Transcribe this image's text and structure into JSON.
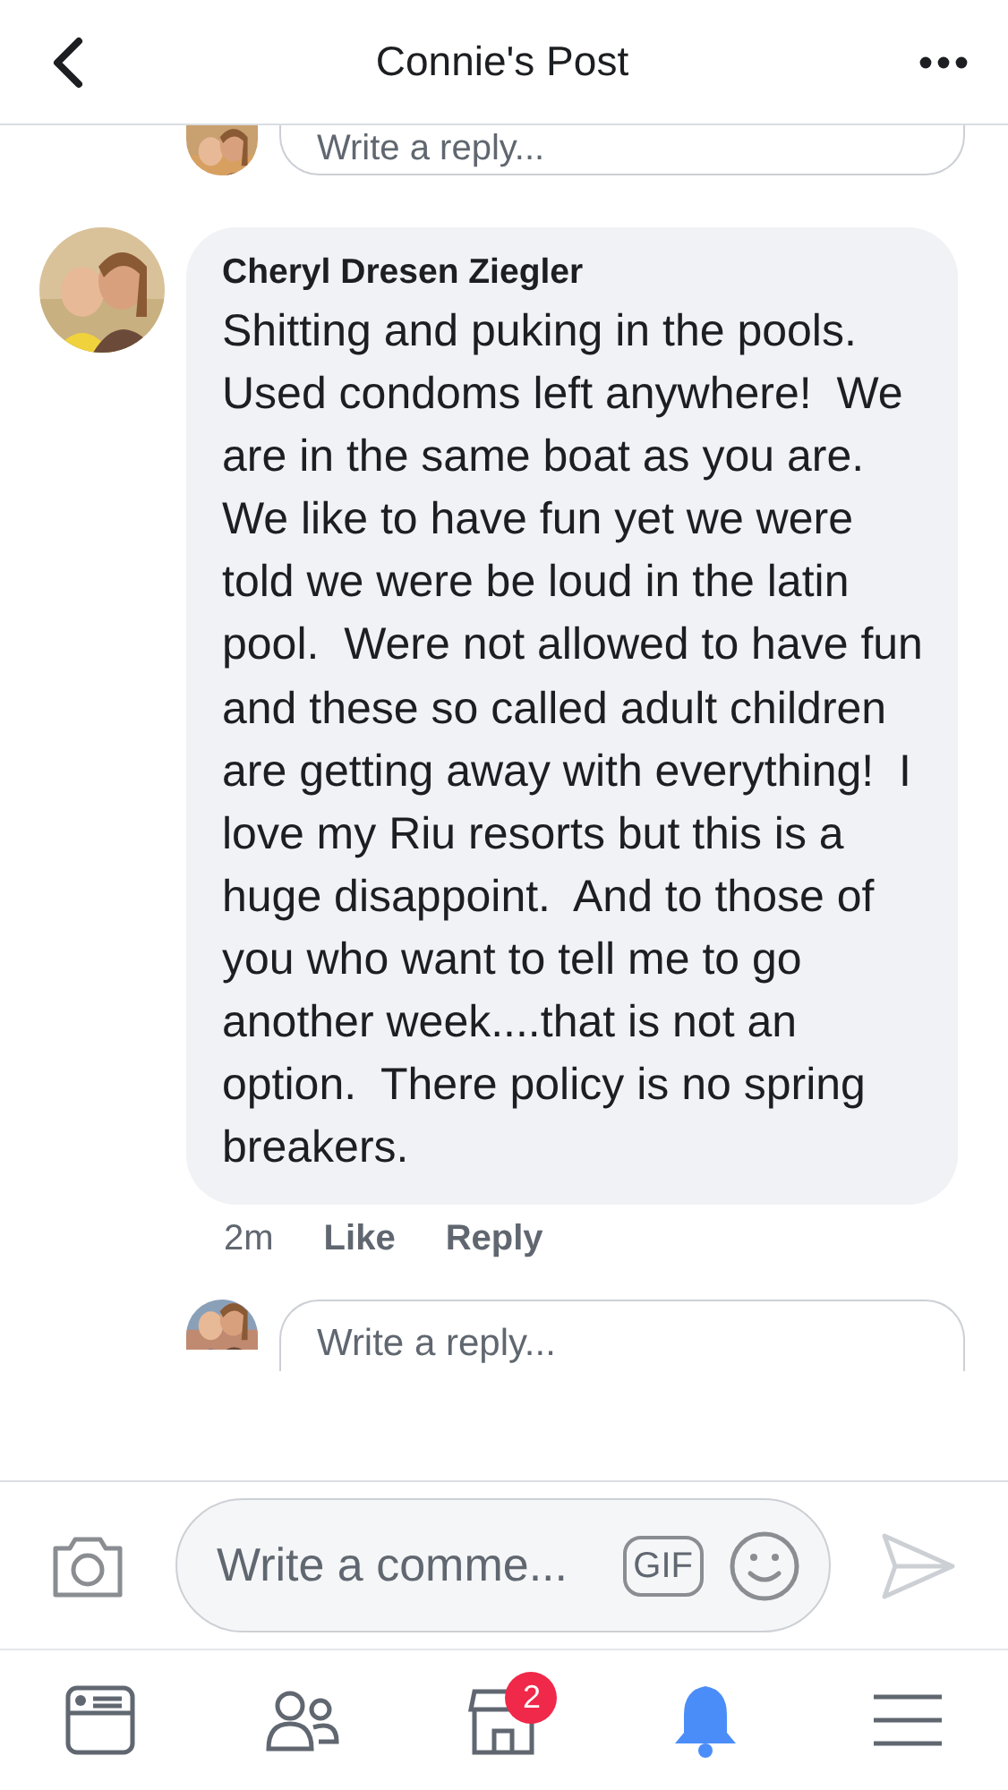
{
  "header": {
    "title": "Connie's Post"
  },
  "top_reply": {
    "placeholder": "Write a reply..."
  },
  "comment": {
    "author": "Cheryl Dresen Ziegler",
    "text": "Shitting and puking in the pools.  Used condoms left anywhere!  We are in the same boat as you are.  We like to have fun yet we were told we were be loud in the latin pool.  Were not allowed to have fun and these so called adult children are getting away with everything!  I love my Riu resorts but this is a huge disappoint.  And to those of you who want to tell me to go another week....that is not an option.  There policy is no spring breakers.",
    "time": "2m",
    "actions": [
      "Like",
      "Reply"
    ]
  },
  "reply": {
    "placeholder": "Write a reply..."
  },
  "composer": {
    "placeholder": "Write a comme...",
    "gif": "GIF"
  },
  "tab_bar": [
    {
      "kind": "feed",
      "selected": false
    },
    {
      "kind": "friends",
      "selected": false
    },
    {
      "kind": "marketplace",
      "selected": false,
      "badge": "2"
    },
    {
      "kind": "notifications",
      "selected": true
    },
    {
      "kind": "menu",
      "selected": false
    }
  ]
}
